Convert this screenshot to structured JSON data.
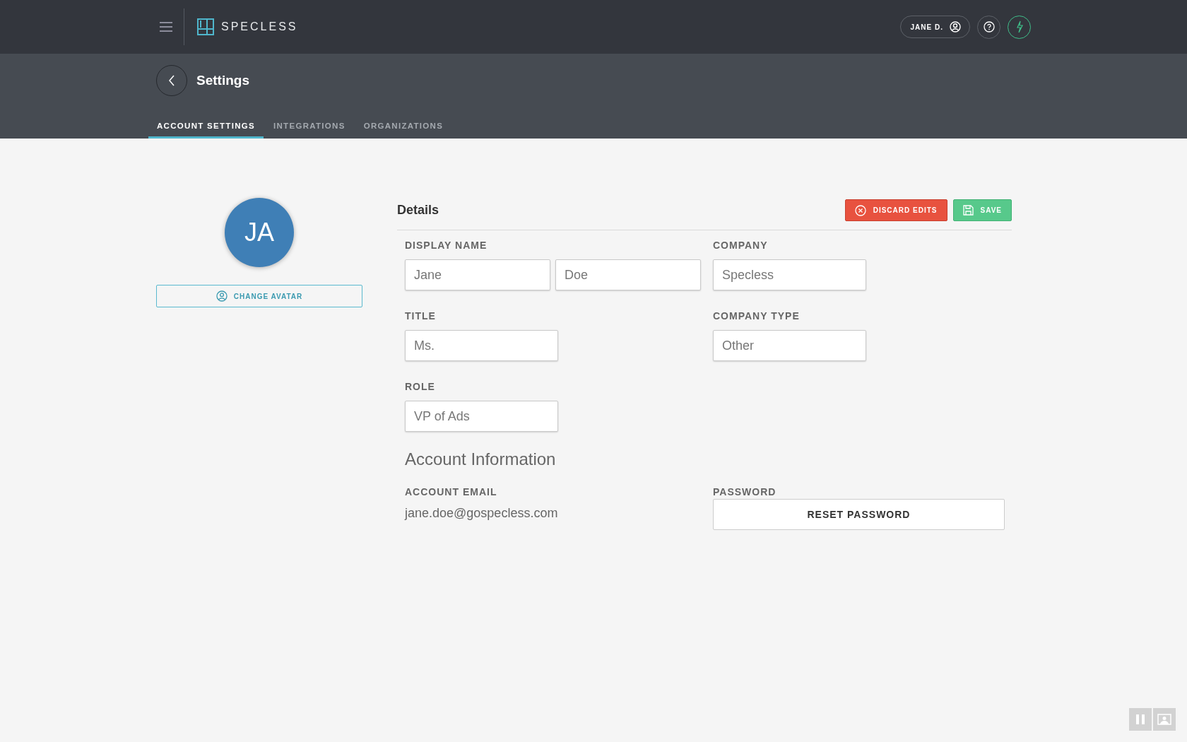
{
  "topbar": {
    "brand": "SPECLESS",
    "user": "JANE D."
  },
  "header": {
    "title": "Settings"
  },
  "tabs": [
    {
      "label": "ACCOUNT SETTINGS",
      "selected": true
    },
    {
      "label": "INTEGRATIONS",
      "selected": false
    },
    {
      "label": "ORGANIZATIONS",
      "selected": false
    }
  ],
  "avatar": {
    "initials": "JA",
    "button": "CHANGE AVATAR"
  },
  "details": {
    "title": "Details",
    "discard": "DISCARD EDITS",
    "save": "SAVE",
    "display_name": {
      "label": "DISPLAY NAME",
      "first": "Jane",
      "last": "Doe"
    },
    "company": {
      "label": "COMPANY",
      "value": "Specless"
    },
    "title_field": {
      "label": "TITLE",
      "value": "Ms."
    },
    "company_type": {
      "label": "COMPANY TYPE",
      "value": "Other"
    },
    "role": {
      "label": "ROLE",
      "value": "VP of Ads"
    }
  },
  "account": {
    "title": "Account Information",
    "email_label": "ACCOUNT EMAIL",
    "email": "jane.doe@gospecless.com",
    "password_label": "PASSWORD",
    "reset": "RESET PASSWORD"
  }
}
